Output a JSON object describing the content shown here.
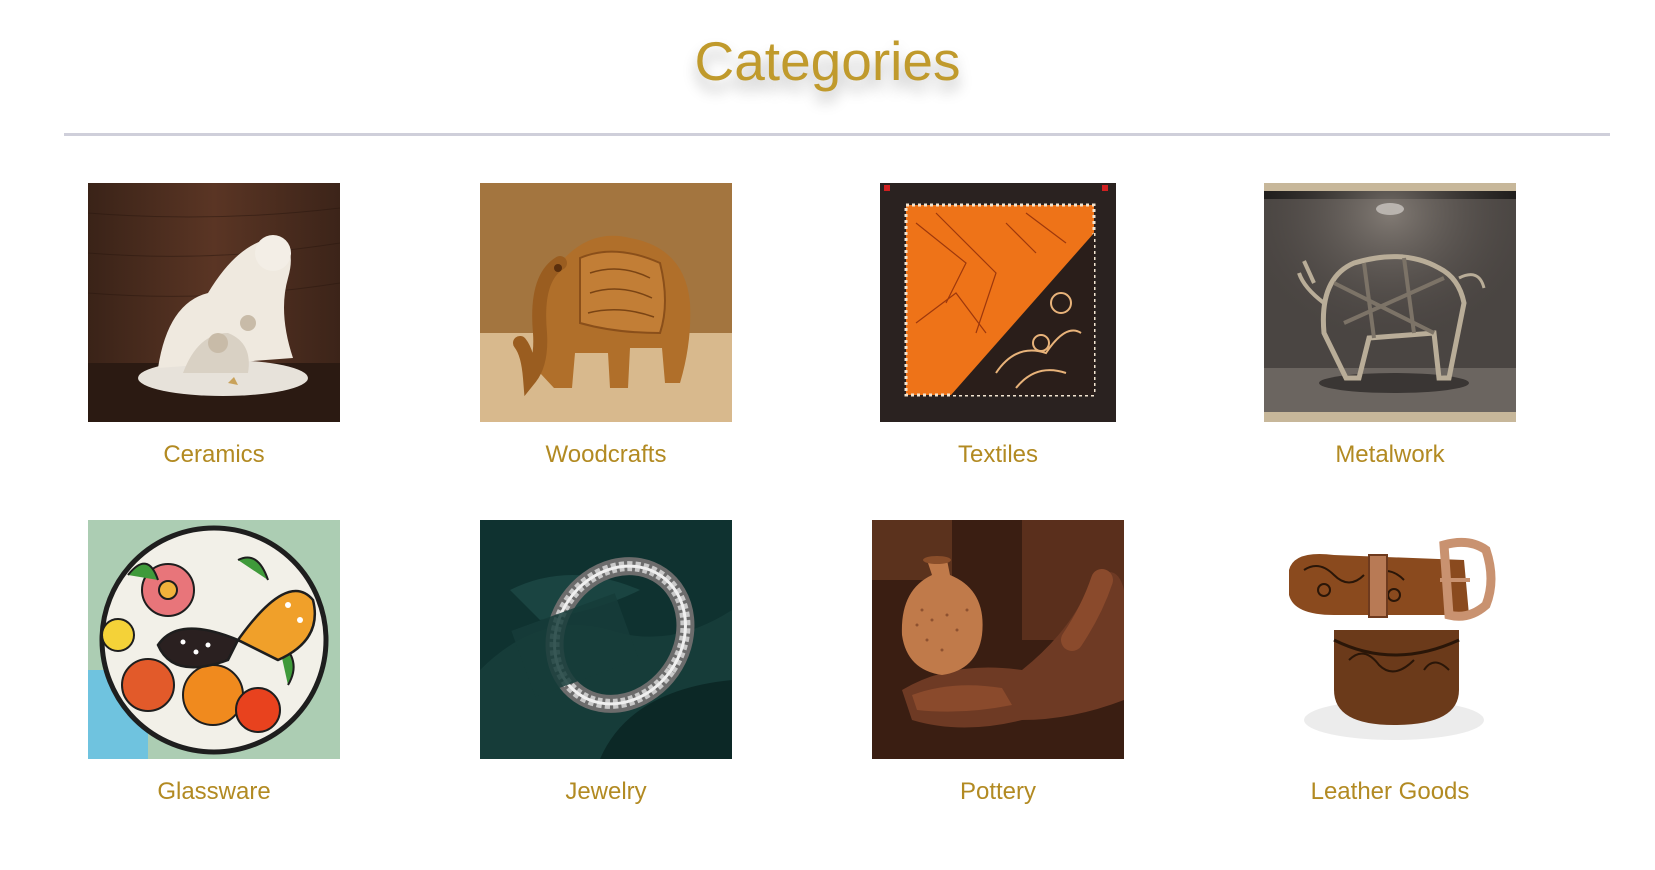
{
  "header": {
    "title": "Categories"
  },
  "colors": {
    "accent": "#b28a22",
    "title": "#c09a2c",
    "divider": "#cfcfda"
  },
  "categories": [
    {
      "label": "Ceramics",
      "icon": "ceramic-tiger-figurine-image"
    },
    {
      "label": "Woodcrafts",
      "icon": "wooden-elephant-image"
    },
    {
      "label": "Textiles",
      "icon": "batik-textile-image"
    },
    {
      "label": "Metalwork",
      "icon": "metal-bull-sculpture-image"
    },
    {
      "label": "Glassware",
      "icon": "stained-glass-butterfly-image"
    },
    {
      "label": "Jewelry",
      "icon": "silver-bangle-image"
    },
    {
      "label": "Pottery",
      "icon": "clay-pot-hand-image"
    },
    {
      "label": "Leather Goods",
      "icon": "tooled-leather-belt-image"
    }
  ]
}
